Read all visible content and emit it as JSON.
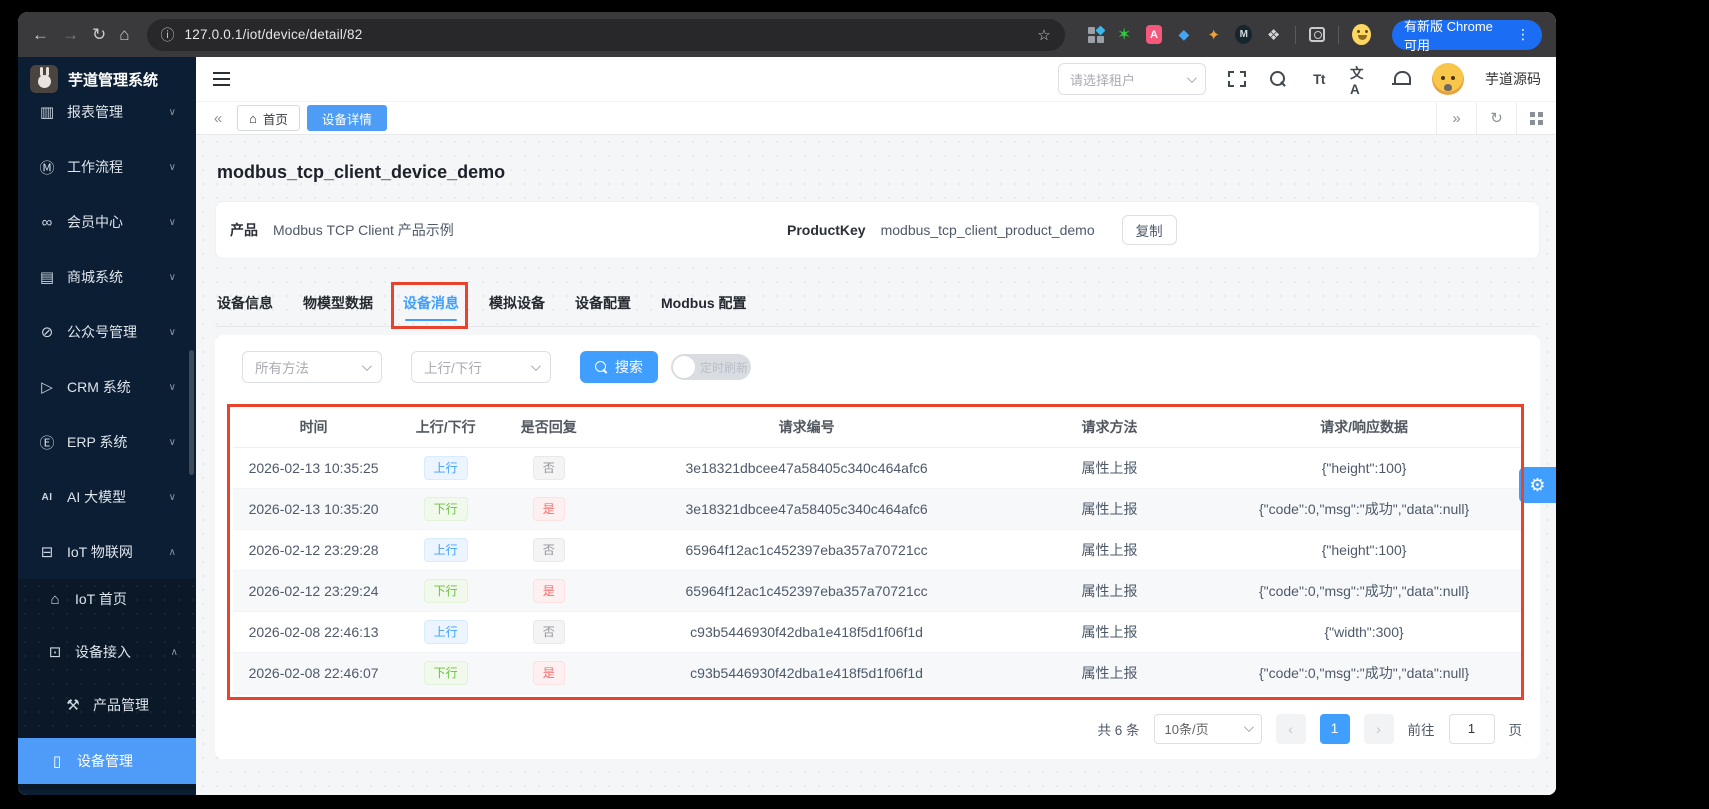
{
  "colors": {
    "primary": "#409eff",
    "sidebar_bg": "#0c1e33",
    "annotation_red": "#e8432d",
    "active_menu_bg": "#4f9cf8",
    "chrome_bar": "#3a3a3c",
    "update_pill_blue": "#1b6ef3"
  },
  "browser": {
    "url": "127.0.0.1/iot/device/detail/82",
    "update_button": "有新版 Chrome 可用",
    "icons": {
      "back": "←",
      "forward": "→",
      "reload": "↻",
      "home": "⌂",
      "info": "ⓘ",
      "bookmark_star": "☆",
      "menu_dots": "⋮",
      "ext_star": "✶",
      "ext_translate": "A",
      "ext_gem": "◆",
      "ext_broom": "✦",
      "ext_m": "M",
      "ext_puzzle": "❖"
    }
  },
  "sidebar": {
    "logo_title": "芋道管理系统",
    "items": [
      {
        "label": "报表管理",
        "icon": "▥",
        "chevron": "∨"
      },
      {
        "label": "工作流程",
        "icon": "Ⓜ",
        "chevron": "∨"
      },
      {
        "label": "会员中心",
        "icon": "∞",
        "chevron": "∨"
      },
      {
        "label": "商城系统",
        "icon": "▤",
        "chevron": "∨"
      },
      {
        "label": "公众号管理",
        "icon": "⊘",
        "chevron": "∨"
      },
      {
        "label": "CRM 系统",
        "icon": "▷",
        "chevron": "∨"
      },
      {
        "label": "ERP 系统",
        "icon": "Ⓔ",
        "chevron": "∨"
      },
      {
        "label": "AI 大模型",
        "icon": "AI",
        "chevron": "∨"
      },
      {
        "label": "IoT 物联网",
        "icon": "⊟",
        "chevron": "∧"
      }
    ],
    "sub_items": [
      {
        "label": "IoT 首页",
        "icon": "⌂"
      },
      {
        "label": "设备接入",
        "icon": "⊡",
        "chevron": "∧"
      },
      {
        "label": "产品管理",
        "icon": "⚒"
      },
      {
        "label": "设备管理",
        "icon": "▯"
      }
    ]
  },
  "header": {
    "tenant_placeholder": "请选择租户",
    "font_icon": "Tt",
    "locale_icon": "文A",
    "username": "芋道源码"
  },
  "tabbar": {
    "collapse_left": "«",
    "home_tab": "首页",
    "active_tab": "设备详情",
    "expand_right": "»",
    "refresh": "↻"
  },
  "page": {
    "title": "modbus_tcp_client_device_demo",
    "product_label": "产品",
    "product_value": "Modbus TCP Client 产品示例",
    "productkey_label": "ProductKey",
    "productkey_value": "modbus_tcp_client_product_demo",
    "copy_button": "复制"
  },
  "tabs": [
    {
      "label": "设备信息"
    },
    {
      "label": "物模型数据"
    },
    {
      "label": "设备消息"
    },
    {
      "label": "模拟设备"
    },
    {
      "label": "设备配置"
    },
    {
      "label": "Modbus 配置"
    }
  ],
  "filters": {
    "method_placeholder": "所有方法",
    "direction_placeholder": "上行/下行",
    "search_button": "搜索",
    "auto_refresh_label": "定时刷新"
  },
  "table": {
    "columns": [
      "时间",
      "上行/下行",
      "是否回复",
      "请求编号",
      "请求方法",
      "请求/响应数据"
    ],
    "rows": [
      {
        "time": "2026-02-13 10:35:25",
        "direction": "上行",
        "reply": "否",
        "request_id": "3e18321dbcee47a58405c340c464afc6",
        "method": "属性上报",
        "data": "{\"height\":100}"
      },
      {
        "time": "2026-02-13 10:35:20",
        "direction": "下行",
        "reply": "是",
        "request_id": "3e18321dbcee47a58405c340c464afc6",
        "method": "属性上报",
        "data": "{\"code\":0,\"msg\":\"成功\",\"data\":null}"
      },
      {
        "time": "2026-02-12 23:29:28",
        "direction": "上行",
        "reply": "否",
        "request_id": "65964f12ac1c452397eba357a70721cc",
        "method": "属性上报",
        "data": "{\"height\":100}"
      },
      {
        "time": "2026-02-12 23:29:24",
        "direction": "下行",
        "reply": "是",
        "request_id": "65964f12ac1c452397eba357a70721cc",
        "method": "属性上报",
        "data": "{\"code\":0,\"msg\":\"成功\",\"data\":null}"
      },
      {
        "time": "2026-02-08 22:46:13",
        "direction": "上行",
        "reply": "否",
        "request_id": "c93b5446930f42dba1e418f5d1f06f1d",
        "method": "属性上报",
        "data": "{\"width\":300}"
      },
      {
        "time": "2026-02-08 22:46:07",
        "direction": "下行",
        "reply": "是",
        "request_id": "c93b5446930f42dba1e418f5d1f06f1d",
        "method": "属性上报",
        "data": "{\"code\":0,\"msg\":\"成功\",\"data\":null}"
      }
    ]
  },
  "pagination": {
    "total": "共 6 条",
    "page_size": "10条/页",
    "prev": "‹",
    "next": "›",
    "current_page": "1",
    "goto_label": "前往",
    "goto_value": "1",
    "page_unit": "页"
  },
  "gear_icon": "⚙"
}
